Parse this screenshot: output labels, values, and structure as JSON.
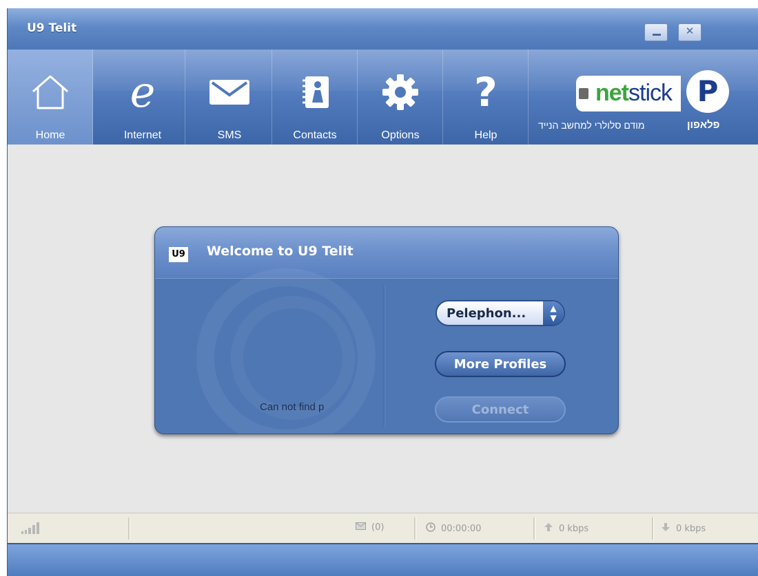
{
  "window": {
    "title": "U9 Telit"
  },
  "nav": {
    "items": [
      {
        "label": "Home",
        "icon": "home-icon"
      },
      {
        "label": "Internet",
        "icon": "internet-icon"
      },
      {
        "label": "SMS",
        "icon": "envelope-icon"
      },
      {
        "label": "Contacts",
        "icon": "contacts-icon"
      },
      {
        "label": "Options",
        "icon": "gear-icon"
      },
      {
        "label": "Help",
        "icon": "help-icon"
      }
    ],
    "active": "Home"
  },
  "branding": {
    "netstick_net": "net",
    "netstick_stick": "stick",
    "netstick_subtitle": "מודם סלולרי למחשב הנייד",
    "pelephone_letter": "P",
    "pelephone_name": "פלאפון"
  },
  "dialog": {
    "logo": "U9",
    "title": "Welcome to U9 Telit",
    "status_text": "Can not find p",
    "profile_select_value": "Pelephon...",
    "more_profiles_label": "More Profiles",
    "connect_label": "Connect"
  },
  "statusbar": {
    "messages": "(0)",
    "duration": "00:00:00",
    "upload": "0 kbps",
    "download": "0 kbps"
  },
  "colors": {
    "toolbar": "#4f78bb",
    "dialog": "#4e77b4",
    "netstick_green": "#3aa63a",
    "pelephone_blue": "#1c3c8c"
  }
}
